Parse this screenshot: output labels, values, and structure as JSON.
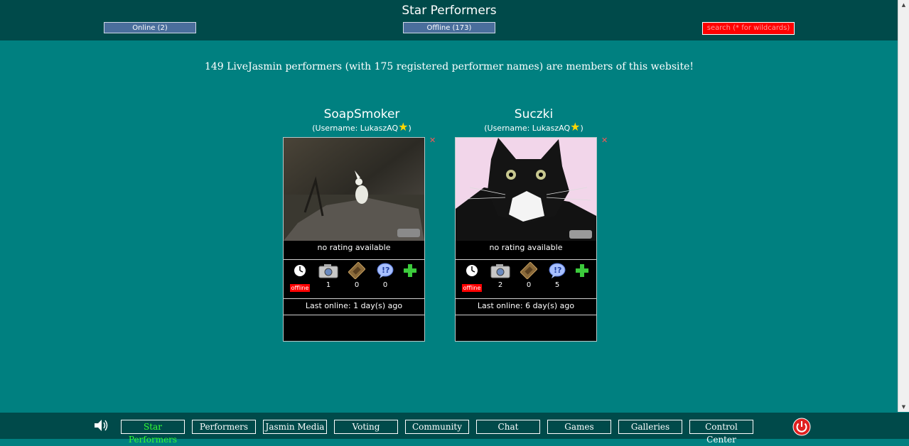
{
  "header": {
    "title": "Star Performers",
    "online_label": "Online (2)",
    "offline_label": "Offline (173)",
    "search_placeholder": "search (* for wildcards)"
  },
  "info_text": "149 LiveJasmin performers (with 175 registered performer names) are members of this website!",
  "performers": [
    {
      "name": "SoapSmoker",
      "username_prefix": "(Username: LukaszAQ",
      "username_suffix": ")",
      "rating": "no rating available",
      "status": "offline",
      "photos": "1",
      "videos": "0",
      "questions": "0",
      "last_online": "Last online: 1 day(s) ago"
    },
    {
      "name": "Suczki",
      "username_prefix": "(Username: LukaszAQ",
      "username_suffix": ")",
      "rating": "no rating available",
      "status": "offline",
      "photos": "2",
      "videos": "0",
      "questions": "5",
      "last_online": "Last online: 6 day(s) ago"
    }
  ],
  "nav": {
    "star_performers": "Star Performers",
    "performers": "Performers",
    "jasmin_media": "Jasmin Media",
    "voting": "Voting",
    "community": "Community",
    "chat": "Chat",
    "games": "Games",
    "galleries": "Galleries",
    "control_center": "Control Center"
  },
  "colors": {
    "background": "#008080",
    "header": "#004a4a",
    "search": "#ff0000",
    "active_nav": "#33ff33"
  }
}
